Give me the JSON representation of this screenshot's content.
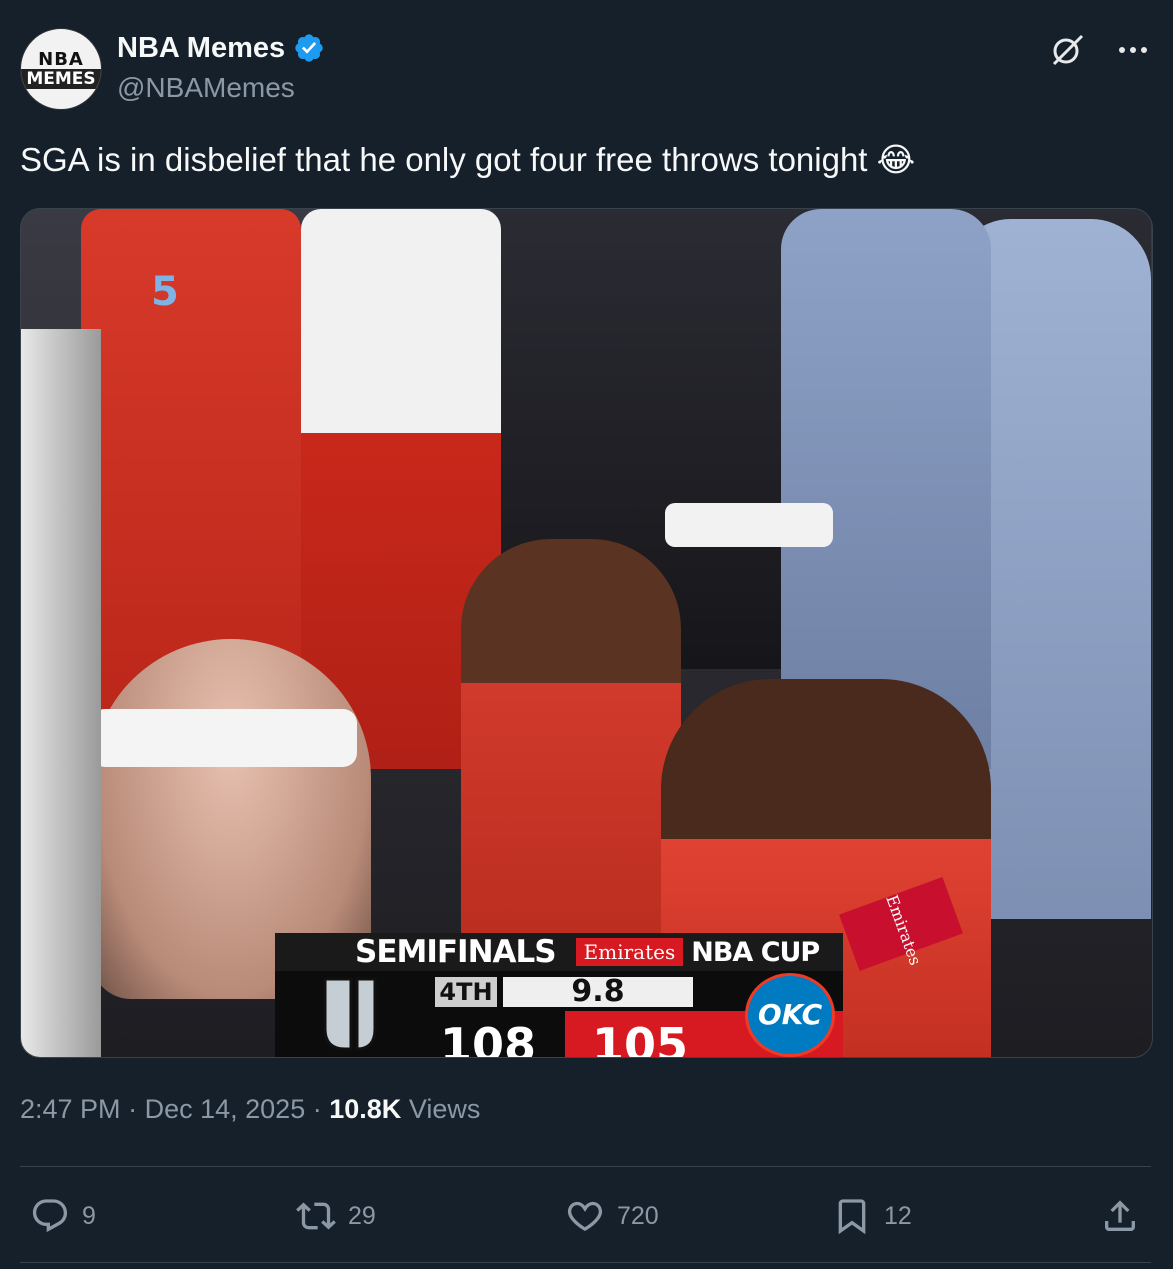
{
  "author": {
    "display_name": "NBA Memes",
    "handle": "@NBAMemes",
    "avatar_top": "NBA",
    "avatar_bottom": "MEMES",
    "verified": true
  },
  "tweet": {
    "text": "SGA is in disbelief that he only got four free throws tonight",
    "emoji": "😂"
  },
  "media": {
    "scoreboard": {
      "round": "SEMIFINALS",
      "sponsor": "Emirates",
      "event": "NBA CUP",
      "quarter": "4TH",
      "clock": "9.8",
      "away_score": "108",
      "home_score": "105",
      "home_logo_text": "OKC"
    },
    "jersey_number": "5",
    "court_sign": "Emirates"
  },
  "meta": {
    "time": "2:47 PM",
    "separator": "·",
    "date": "Dec 14, 2025",
    "views_count": "10.8K",
    "views_label": "Views"
  },
  "actions": {
    "replies": "9",
    "reposts": "29",
    "likes": "720",
    "bookmarks": "12"
  },
  "colors": {
    "background": "#15202b",
    "verified": "#1d9bf0",
    "muted_text": "#8b98a5",
    "okc_red": "#d71a21"
  },
  "icons": [
    "verified-badge-icon",
    "grok-icon",
    "more-icon",
    "reply-icon",
    "repost-icon",
    "like-icon",
    "bookmark-icon",
    "share-icon"
  ]
}
